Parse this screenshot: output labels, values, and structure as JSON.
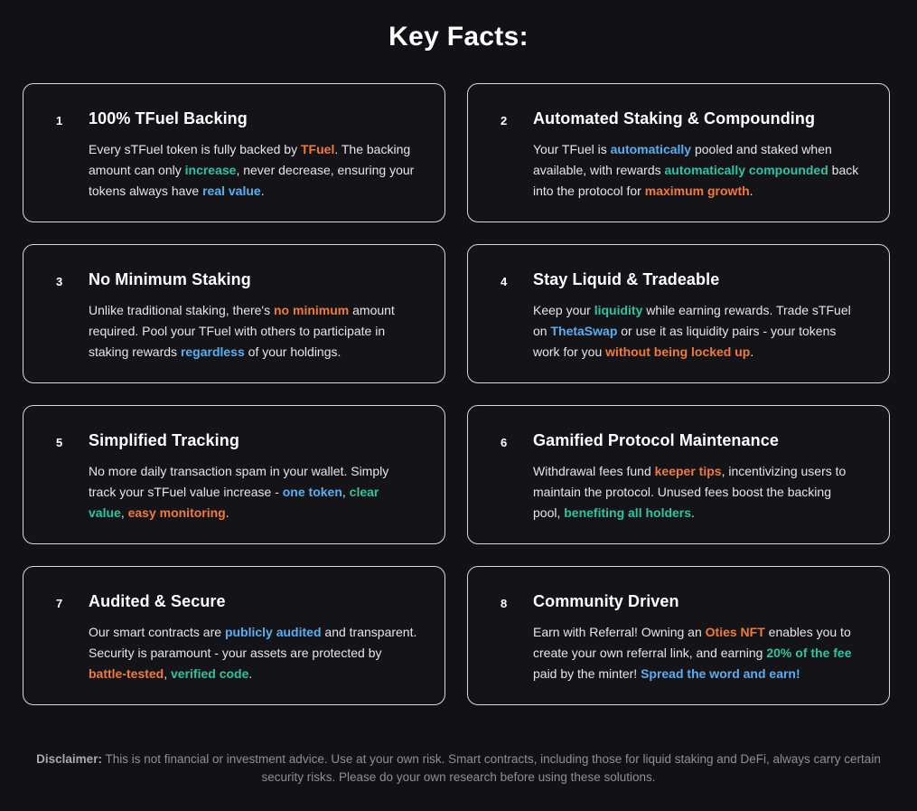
{
  "page": {
    "title": "Key Facts:"
  },
  "cards": [
    {
      "number": "1",
      "title": "100% TFuel Backing",
      "body": [
        {
          "t": "Every sTFuel token is fully backed by "
        },
        {
          "t": "TFuel",
          "c": "orange"
        },
        {
          "t": ". The backing amount can only "
        },
        {
          "t": "increase",
          "c": "teal"
        },
        {
          "t": ", never decrease, ensuring your tokens always have "
        },
        {
          "t": "real value",
          "c": "blue"
        },
        {
          "t": "."
        }
      ]
    },
    {
      "number": "2",
      "title": "Automated Staking & Compounding",
      "body": [
        {
          "t": "Your TFuel is "
        },
        {
          "t": "automatically",
          "c": "blue"
        },
        {
          "t": " pooled and staked when available, with rewards "
        },
        {
          "t": "automatically compounded",
          "c": "teal"
        },
        {
          "t": " back into the protocol for "
        },
        {
          "t": "maximum growth",
          "c": "orange"
        },
        {
          "t": "."
        }
      ]
    },
    {
      "number": "3",
      "title": "No Minimum Staking",
      "body": [
        {
          "t": "Unlike traditional staking, there's "
        },
        {
          "t": "no minimum",
          "c": "orange"
        },
        {
          "t": " amount required. Pool your TFuel with others to participate in staking rewards "
        },
        {
          "t": "regardless",
          "c": "blue"
        },
        {
          "t": " of your holdings."
        }
      ]
    },
    {
      "number": "4",
      "title": "Stay Liquid & Tradeable",
      "body": [
        {
          "t": "Keep your "
        },
        {
          "t": "liquidity",
          "c": "teal"
        },
        {
          "t": " while earning rewards. Trade sTFuel on "
        },
        {
          "t": "ThetaSwap",
          "c": "blue"
        },
        {
          "t": " or use it as liquidity pairs - your tokens work for you "
        },
        {
          "t": "without being locked up",
          "c": "orange"
        },
        {
          "t": "."
        }
      ]
    },
    {
      "number": "5",
      "title": "Simplified Tracking",
      "body": [
        {
          "t": "No more daily transaction spam in your wallet. Simply track your sTFuel value increase - "
        },
        {
          "t": "one token",
          "c": "blue"
        },
        {
          "t": ", "
        },
        {
          "t": "clear value",
          "c": "teal"
        },
        {
          "t": ", "
        },
        {
          "t": "easy monitoring",
          "c": "orange"
        },
        {
          "t": "."
        }
      ]
    },
    {
      "number": "6",
      "title": "Gamified Protocol Maintenance",
      "body": [
        {
          "t": "Withdrawal fees fund "
        },
        {
          "t": "keeper tips",
          "c": "orange"
        },
        {
          "t": ", incentivizing users to maintain the protocol. Unused fees boost the backing pool, "
        },
        {
          "t": "benefiting all holders",
          "c": "teal"
        },
        {
          "t": "."
        }
      ]
    },
    {
      "number": "7",
      "title": "Audited & Secure",
      "body": [
        {
          "t": "Our smart contracts are "
        },
        {
          "t": "publicly audited",
          "c": "blue"
        },
        {
          "t": " and transparent. Security is paramount - your assets are protected by "
        },
        {
          "t": "battle-tested",
          "c": "orange"
        },
        {
          "t": ", "
        },
        {
          "t": "verified code",
          "c": "teal"
        },
        {
          "t": "."
        }
      ]
    },
    {
      "number": "8",
      "title": "Community Driven",
      "body": [
        {
          "t": "Earn with Referral! Owning an "
        },
        {
          "t": "Oties NFT",
          "c": "orange"
        },
        {
          "t": " enables you to create your own referral link, and earning "
        },
        {
          "t": "20% of the fee",
          "c": "teal"
        },
        {
          "t": " paid by the minter! "
        },
        {
          "t": "Spread the word and earn!",
          "c": "blue"
        }
      ]
    }
  ],
  "disclaimer": {
    "label": "Disclaimer:",
    "text": " This is not financial or investment advice. Use at your own risk. Smart contracts, including those for liquid staking and DeFi, always carry certain security risks. Please do your own research before using these solutions."
  },
  "colors": {
    "orange": "#f07a3c",
    "teal": "#2ec4a0",
    "blue": "#5aaef0",
    "background": "#121216",
    "card_border": "#d8d8dc"
  }
}
